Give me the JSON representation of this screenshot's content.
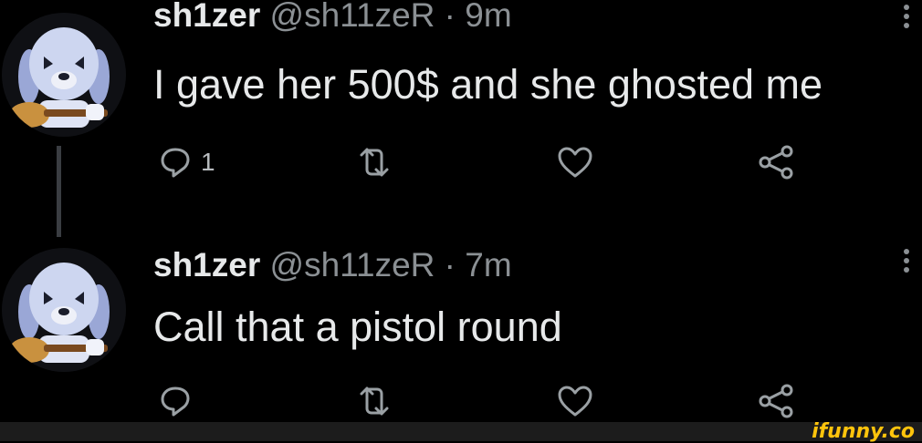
{
  "tweets": [
    {
      "name": "sh1zer",
      "handle": "@sh11zeR",
      "separator": "·",
      "time": "9m",
      "text": "I gave her 500$ and she ghosted me",
      "reply_count": "1"
    },
    {
      "name": "sh1zer",
      "handle": "@sh11zeR",
      "separator": "·",
      "time": "7m",
      "text": "Call that a pistol round",
      "reply_count": ""
    }
  ],
  "watermark": "ifunny.co",
  "colors": {
    "background": "#000000",
    "text": "#e7e9ea",
    "muted": "#8b9094",
    "brand": "#ffc40c"
  },
  "icons": [
    "more-icon",
    "reply-icon",
    "retweet-icon",
    "like-icon",
    "share-icon",
    "avatar-image"
  ]
}
